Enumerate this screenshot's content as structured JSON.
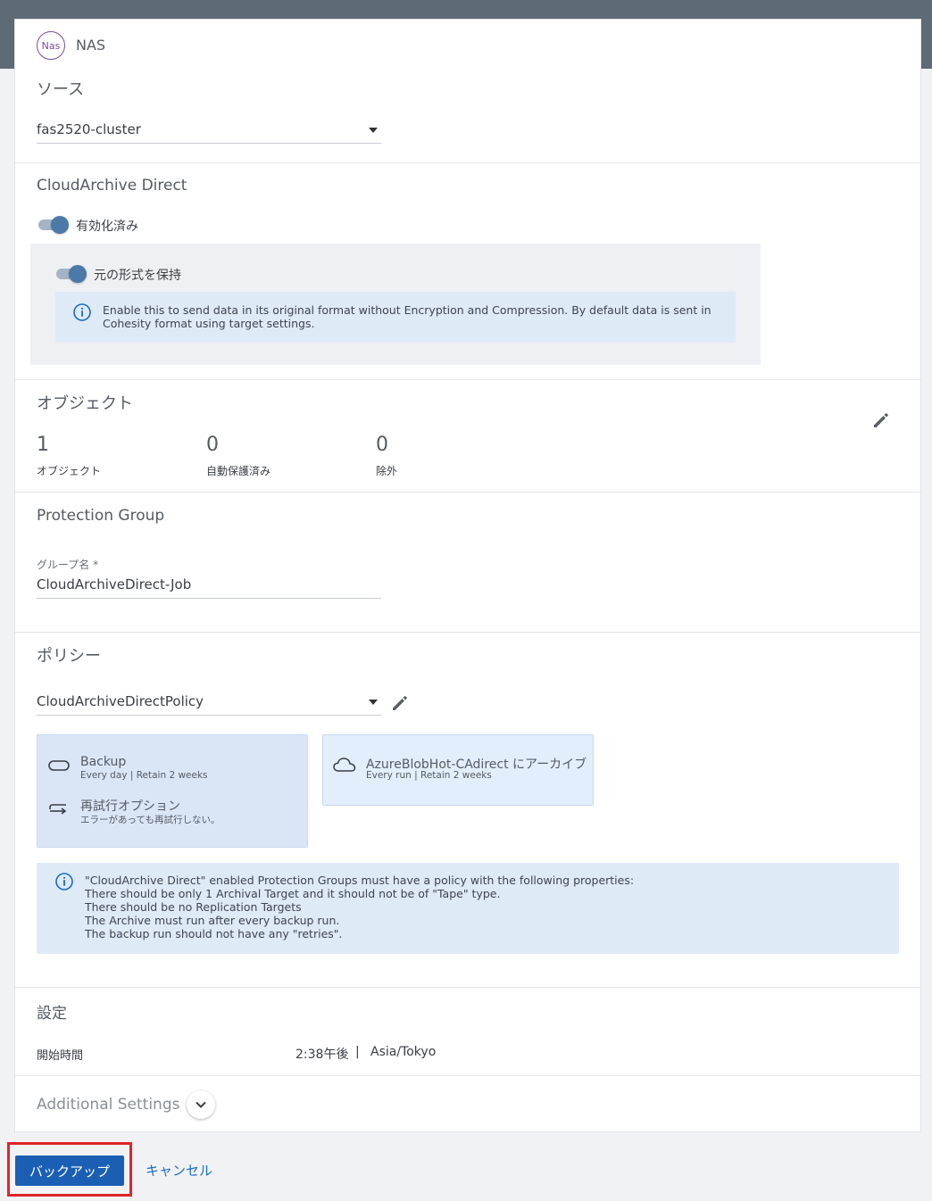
{
  "source_type": {
    "badge": "Nas",
    "label": "NAS"
  },
  "source": {
    "title": "ソース",
    "value": "fas2520-cluster"
  },
  "cloud_archive": {
    "title": "CloudArchive Direct",
    "enabled_label": "有効化済み",
    "keep_format_label": "元の形式を保持",
    "info_line1": "Enable this to send data in its original format without Encryption and Compression. By default data is sent in",
    "info_line2": "Cohesity format using target settings."
  },
  "objects": {
    "title": "オブジェクト",
    "stats": [
      {
        "value": "1",
        "label": "オブジェクト"
      },
      {
        "value": "0",
        "label": "自動保護済み"
      },
      {
        "value": "0",
        "label": "除外"
      }
    ]
  },
  "protection_group": {
    "title": "Protection Group",
    "name_label": "グループ名 *",
    "name_value": "CloudArchiveDirect-Job"
  },
  "policy": {
    "title": "ポリシー",
    "value": "CloudArchiveDirectPolicy",
    "backup_title": "Backup",
    "backup_sub": "Every day  |  Retain 2 weeks",
    "retry_title": "再試行オプション",
    "retry_sub": "エラーがあっても再試行しない。",
    "archive_title": "AzureBlobHot-CAdirect にアーカイブ",
    "archive_sub": "Every run  |  Retain 2 weeks",
    "info_lines": [
      "\"CloudArchive Direct\" enabled Protection Groups must have a policy with the following properties:",
      "There should be only 1 Archival Target and it should not be of \"Tape\" type.",
      "There should be no Replication Targets",
      "The Archive must run after every backup run.",
      "The backup run should not have any \"retries\"."
    ]
  },
  "settings": {
    "title": "設定",
    "start_label": "開始時間",
    "start_time": "2:38午後",
    "separator": "|",
    "timezone": "Asia/Tokyo"
  },
  "additional_settings": {
    "label": "Additional Settings"
  },
  "footer": {
    "backup_button": "バックアップ",
    "cancel_button": "キャンセル"
  },
  "colors": {
    "primary": "#1a5fb4",
    "header": "#5e6a75",
    "highlight": "#e0242b",
    "accent_purple": "#7a4ba3"
  }
}
